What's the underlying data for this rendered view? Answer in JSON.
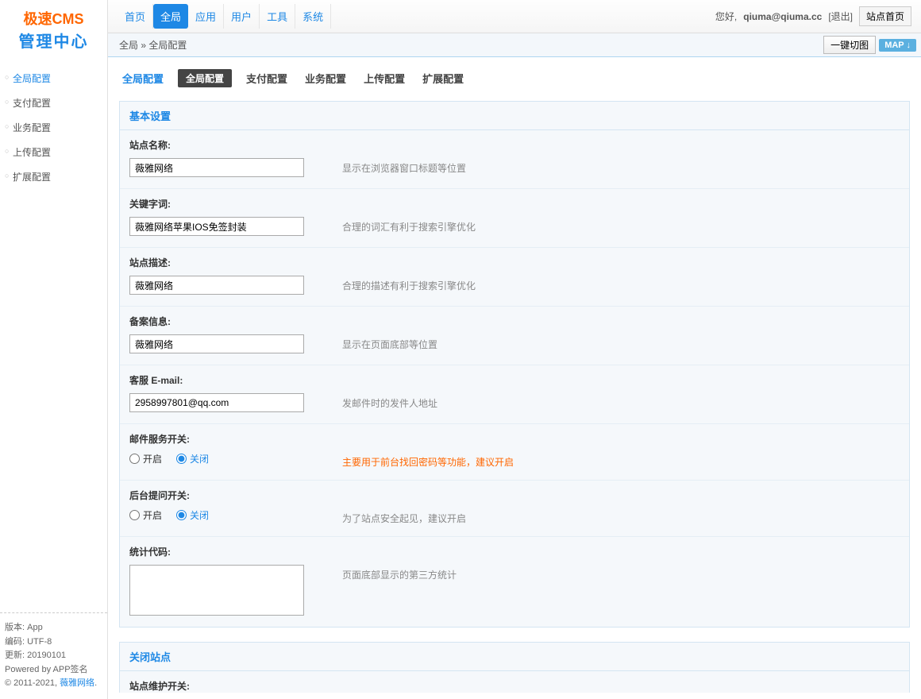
{
  "logo": {
    "line1": "极速CMS",
    "line2": "管理中心"
  },
  "topnav": {
    "items": [
      "首页",
      "全局",
      "应用",
      "用户",
      "工具",
      "系统"
    ],
    "activeIndex": 1
  },
  "topbar": {
    "greeting": "您好,",
    "user": "qiuma@qiuma.cc",
    "logout": "[退出]",
    "homeBtn": "站点首页"
  },
  "breadcrumb": {
    "seg1": "全局",
    "sep": "»",
    "seg2": "全局配置",
    "switchBtn": "一键切图",
    "mapBtn": "MAP"
  },
  "sidebar": {
    "items": [
      "全局配置",
      "支付配置",
      "业务配置",
      "上传配置",
      "扩展配置"
    ],
    "activeIndex": 0,
    "footer": {
      "l1": "版本: App",
      "l2": "编码: UTF-8",
      "l3": "更新: 20190101",
      "l4": "Powered by APP签名",
      "l5_pre": "© 2011-2021, ",
      "l5_link": "薇雅网络",
      "l5_post": "."
    }
  },
  "tabs": {
    "items": [
      "全局配置",
      "全局配置",
      "支付配置",
      "业务配置",
      "上传配置",
      "扩展配置"
    ]
  },
  "panels": {
    "basic": {
      "title": "基本设置"
    },
    "close": {
      "title": "关闭站点"
    }
  },
  "form": {
    "siteName": {
      "label": "站点名称:",
      "value": "薇雅网络",
      "hint": "显示在浏览器窗口标题等位置"
    },
    "keywords": {
      "label": "关键字词:",
      "value": "薇雅网络苹果IOS免签封装",
      "hint": "合理的词汇有利于搜索引擎优化"
    },
    "description": {
      "label": "站点描述:",
      "value": "薇雅网络",
      "hint": "合理的描述有利于搜索引擎优化"
    },
    "beian": {
      "label": "备案信息:",
      "value": "薇雅网络",
      "hint": "显示在页面底部等位置"
    },
    "email": {
      "label": "客服 E-mail:",
      "value": "2958997801@qq.com",
      "hint": "发邮件时的发件人地址"
    },
    "mailSwitch": {
      "label": "邮件服务开关:",
      "on": "开启",
      "off": "关闭",
      "hint": "主要用于前台找回密码等功能，建议开启"
    },
    "questionSwitch": {
      "label": "后台提问开关:",
      "on": "开启",
      "off": "关闭",
      "hint": "为了站点安全起见，建议开启"
    },
    "statCode": {
      "label": "统计代码:",
      "value": "",
      "hint": "页面底部显示的第三方统计"
    },
    "maintain": {
      "label": "站点维护开关:"
    }
  }
}
